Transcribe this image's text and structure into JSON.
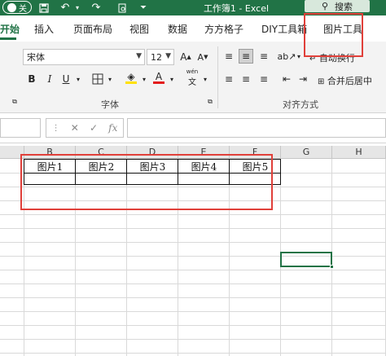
{
  "titlebar": {
    "autosave": "关",
    "title": "工作簿1  -  Excel",
    "search": "搜索"
  },
  "tabs": [
    "开始",
    "插入",
    "页面布局",
    "视图",
    "数据",
    "方方格子",
    "DIY工具箱",
    "图片工具"
  ],
  "ribbon": {
    "font_name": "宋体",
    "font_size": "12",
    "grow_font": "A",
    "shrink_font": "A",
    "bold": "B",
    "italic": "I",
    "underline": "U",
    "font_color_letter": "A",
    "phonetic": "wén",
    "wrap_text": "自动换行",
    "merge_center": "合并后居中",
    "group_font": "字体",
    "group_alignment": "对齐方式",
    "colors": {
      "font_color": "#e31b1b",
      "fill_color": "#ffe100"
    }
  },
  "formulabar": {
    "cancel": "✕",
    "enter": "✓",
    "fx": "fx",
    "value": ""
  },
  "columns": [
    "B",
    "C",
    "D",
    "E",
    "F",
    "G",
    "H"
  ],
  "table_cells": [
    "图片1",
    "图片2",
    "图片3",
    "图片4",
    "图片5"
  ]
}
